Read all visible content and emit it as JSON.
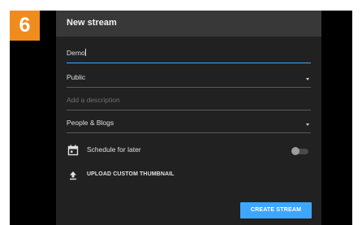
{
  "step": {
    "number": "6",
    "color": "#f08c1e"
  },
  "dialog": {
    "title": "New stream",
    "title_field": {
      "value": "Demo"
    },
    "visibility": {
      "selected": "Public",
      "icon": "chevron-down-icon"
    },
    "description": {
      "placeholder": "Add a description",
      "value": ""
    },
    "category": {
      "selected": "People & Blogs",
      "icon": "chevron-down-icon"
    },
    "schedule": {
      "label": "Schedule for later",
      "icon": "calendar-icon",
      "enabled": false
    },
    "thumbnail": {
      "label": "UPLOAD CUSTOM THUMBNAIL",
      "icon": "upload-icon"
    },
    "create_button": {
      "label": "CREATE STREAM",
      "color": "#3ea6ff"
    }
  },
  "theme": {
    "dialog_bg": "#212121",
    "header_bg": "#383838",
    "accent": "#3ea6ff"
  }
}
